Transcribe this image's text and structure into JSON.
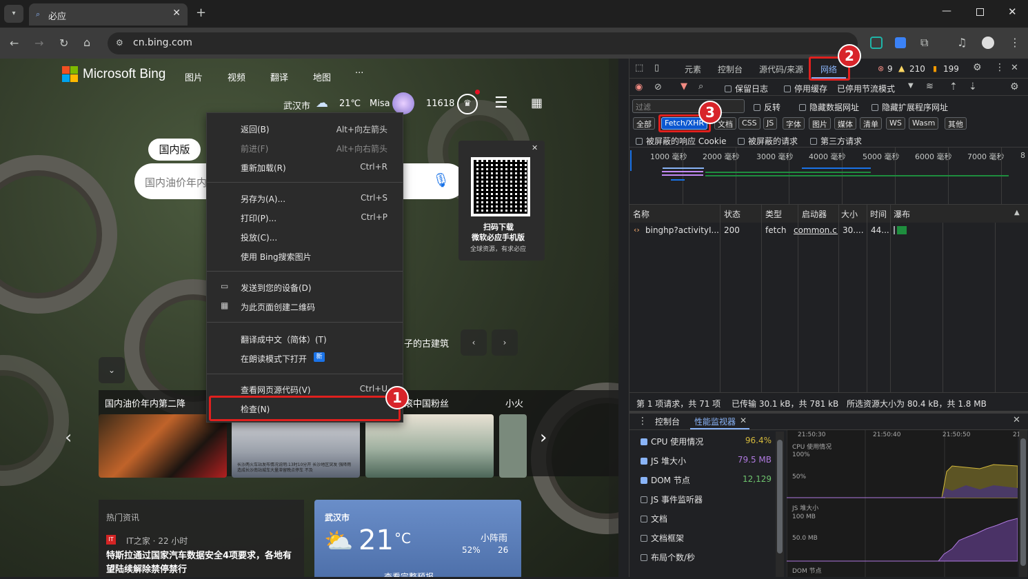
{
  "browser": {
    "tab_title": "必应",
    "url": "cn.bing.com"
  },
  "bing": {
    "logo": "Microsoft Bing",
    "nav": [
      "图片",
      "视频",
      "翻译",
      "地图",
      "···"
    ],
    "city": "武汉市",
    "temp": "21℃",
    "user": "Misa",
    "points": "11618",
    "region_tab": "国内版",
    "search_placeholder": "国内油价年内",
    "qr_title": "扫码下载",
    "qr_sub": "微软必应手机版",
    "qr_small": "全球资源，有求必应",
    "carousel_label": "子的古建筑",
    "card1": "国内油价年内第二降",
    "card3": "滚中国粉丝",
    "card4": "小火",
    "card2_caption": "长沙两火车站发布情况说明:13时10分开 长沙地区突发 强降雨 造成长沙南站城车大量滞留晚点停车 不及",
    "news_header": "热门资讯",
    "news_source": "IT之家 · 22 小时",
    "news_title": "特斯拉通过国家汽车数据安全4项要求，各地有望陆续解除禁停禁行",
    "weather_city": "武汉市",
    "weather_temp": "21",
    "weather_unit": "°C",
    "weather_desc": "小阵雨",
    "weather_humidity": "52%",
    "weather_wind": "26",
    "weather_link": "查看完整预报"
  },
  "context_menu": [
    {
      "label": "返回(B)",
      "key": "Alt+向左箭头"
    },
    {
      "label": "前进(F)",
      "key": "Alt+向右箭头"
    },
    {
      "label": "重新加载(R)",
      "key": "Ctrl+R"
    },
    {
      "label": "另存为(A)...",
      "key": "Ctrl+S"
    },
    {
      "label": "打印(P)...",
      "key": "Ctrl+P"
    },
    {
      "label": "投放(C)...",
      "key": ""
    },
    {
      "label": "使用 Bing搜索图片",
      "key": ""
    },
    {
      "label": "发送到您的设备(D)",
      "key": ""
    },
    {
      "label": "为此页面创建二维码",
      "key": ""
    },
    {
      "label": "翻译成中文（简体）(T)",
      "key": ""
    },
    {
      "label": "在朗读模式下打开",
      "key": ""
    },
    {
      "label": "查看网页源代码(V)",
      "key": "Ctrl+U"
    },
    {
      "label": "检查(N)",
      "key": ""
    }
  ],
  "menu_new_badge": "新",
  "annotations": [
    "1",
    "2",
    "3"
  ],
  "devtools": {
    "tabs": [
      "元素",
      "控制台",
      "源代码/来源",
      "网络"
    ],
    "errors": "9",
    "warnings": "210",
    "issues": "199",
    "toolbar": {
      "preserve_log": "保留日志",
      "disable_cache": "停用缓存",
      "throttle": "已停用节流模式"
    },
    "filter_placeholder": "过滤",
    "invert": "反转",
    "hide_data": "隐藏数据网址",
    "hide_ext": "隐藏扩展程序网址",
    "type_filters": [
      "全部",
      "Fetch/XHR",
      "文档",
      "CSS",
      "JS",
      "字体",
      "图片",
      "媒体",
      "清单",
      "WS",
      "Wasm",
      "其他"
    ],
    "blocked_cookies": "被屏蔽的响应 Cookie",
    "blocked_requests": "被屏蔽的请求",
    "third_party": "第三方请求",
    "timeline_ticks": [
      "1000 毫秒",
      "2000 毫秒",
      "3000 毫秒",
      "4000 毫秒",
      "5000 毫秒",
      "6000 毫秒",
      "7000 毫秒",
      "8"
    ],
    "columns": [
      "名称",
      "状态",
      "类型",
      "启动器",
      "大小",
      "时间",
      "瀑布"
    ],
    "row": {
      "name": "binghp?activityI...",
      "status": "200",
      "type": "fetch",
      "initiator": "common.c1",
      "size": "30....",
      "time": "44..."
    },
    "summary": [
      "第 1 项请求，共 71 项",
      "已传输 30.1 kB，共 781 kB",
      "所选资源大小为 80.4 kB，共 1.8 MB"
    ],
    "drawer_tabs": [
      "控制台",
      "性能监视器"
    ],
    "perf": [
      {
        "label": "CPU 使用情况",
        "value": "96.4%",
        "on": true,
        "color": "#d4b93c"
      },
      {
        "label": "JS 堆大小",
        "value": "79.5 MB",
        "on": true,
        "color": "#b07ae0"
      },
      {
        "label": "DOM 节点",
        "value": "12,129",
        "on": true,
        "color": "#6ec46e"
      },
      {
        "label": "JS 事件监听器",
        "value": "",
        "on": false,
        "color": ""
      },
      {
        "label": "文档",
        "value": "",
        "on": false,
        "color": ""
      },
      {
        "label": "文档框架",
        "value": "",
        "on": false,
        "color": ""
      },
      {
        "label": "布局个数/秒",
        "value": "",
        "on": false,
        "color": ""
      }
    ],
    "perf_times": [
      "21:50:30",
      "21:50:40",
      "21:50:50",
      "21"
    ],
    "perf_labels": [
      "CPU 使用情况",
      "100%",
      "50%",
      "JS 堆大小",
      "100 MB",
      "50.0 MB",
      "DOM 节点"
    ]
  }
}
